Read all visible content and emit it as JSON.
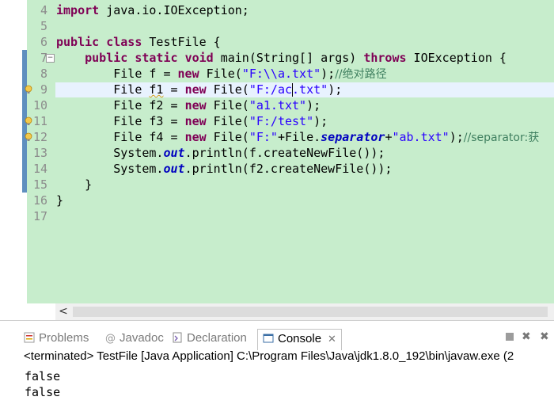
{
  "editor": {
    "lines": [
      {
        "n": "4",
        "html_key": "l4"
      },
      {
        "n": "5"
      },
      {
        "n": "6"
      },
      {
        "n": "7"
      },
      {
        "n": "8"
      },
      {
        "n": "9"
      },
      {
        "n": "10"
      },
      {
        "n": "11"
      },
      {
        "n": "12"
      },
      {
        "n": "13"
      },
      {
        "n": "14"
      },
      {
        "n": "15"
      },
      {
        "n": "16"
      },
      {
        "n": "17"
      }
    ],
    "code": {
      "l4_kw": "import",
      "l4_rest": " java.io.IOException;",
      "l6_kw1": "public",
      "l6_kw2": "class",
      "l6_rest": " TestFile {",
      "l7_kw1": "public",
      "l7_kw2": "static",
      "l7_kw3": "void",
      "l7_mid": " main(String[] args) ",
      "l7_kw4": "throws",
      "l7_rest": " IOException {",
      "l8_a": "File f = ",
      "l8_new": "new",
      "l8_b": " File(",
      "l8_str": "\"F:\\\\a.txt\"",
      "l8_c": ");",
      "l8_cmt": "//绝对路径",
      "l9_a": "File ",
      "l9_var": "f1",
      "l9_b": " = ",
      "l9_new": "new",
      "l9_c": " File(",
      "l9_str": "\"F:/ac.txt\"",
      "l9_d": ");",
      "l10_a": "File f2 = ",
      "l10_new": "new",
      "l10_b": " File(",
      "l10_str": "\"a1.txt\"",
      "l10_c": ");",
      "l11_a": "File f3 = ",
      "l11_new": "new",
      "l11_b": " File(",
      "l11_str": "\"F:/test\"",
      "l11_c": ");",
      "l12_a": "File f4 = ",
      "l12_new": "new",
      "l12_b": " File(",
      "l12_str1": "\"F:\"",
      "l12_c": "+File.",
      "l12_field": "separator",
      "l12_d": "+",
      "l12_str2": "\"ab.txt\"",
      "l12_e": ");",
      "l12_cmt": "//separator:获",
      "l13_a": "System.",
      "l13_field": "out",
      "l13_b": ".println(f.createNewFile());",
      "l14_a": "System.",
      "l14_field": "out",
      "l14_b": ".println(f2.createNewFile());",
      "l15": "}",
      "l16": "}"
    }
  },
  "console": {
    "tabs": {
      "problems": "Problems",
      "javadoc": "Javadoc",
      "declaration": "Declaration",
      "console": "Console"
    },
    "status_line": "<terminated> TestFile [Java Application] C:\\Program Files\\Java\\jdk1.8.0_192\\bin\\javaw.exe (2",
    "output": [
      "false",
      "false"
    ]
  },
  "colors": {
    "editor_bg": "#c7edcc",
    "keyword": "#7f0055",
    "string": "#2a00ff",
    "comment": "#3f7f5f",
    "field": "#0000c0"
  }
}
